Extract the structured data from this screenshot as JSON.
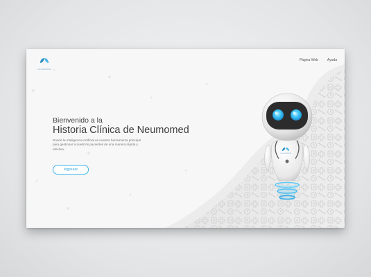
{
  "header": {
    "logo_text": "neumomed",
    "nav": [
      {
        "label": "Página Web"
      },
      {
        "label": "Ayuda"
      }
    ]
  },
  "hero": {
    "subtitle": "Bienvenido a la",
    "title": "Historia Clínica de Neumomed",
    "description": "Donde la Inteligencia Artificial es nuestra herramienta principal para gestionar a nuestros pacientes de una manera rápida y efectiva.",
    "cta_label": "Ingresar"
  },
  "robot": {
    "badge_text": "neumomed"
  },
  "colors": {
    "accent": "#2aa3dc",
    "accent_light": "#5cc9f5",
    "robot_face": "#2c2c2c",
    "background_wave": "#e9e9e9"
  },
  "icons": [
    "neumomed-logo-icon",
    "heart-icon",
    "medical-cross-icon",
    "clipboard-icon",
    "pill-icon",
    "dumbbell-icon",
    "clock-icon",
    "stethoscope-icon",
    "trophy-icon",
    "lungs-icon"
  ]
}
